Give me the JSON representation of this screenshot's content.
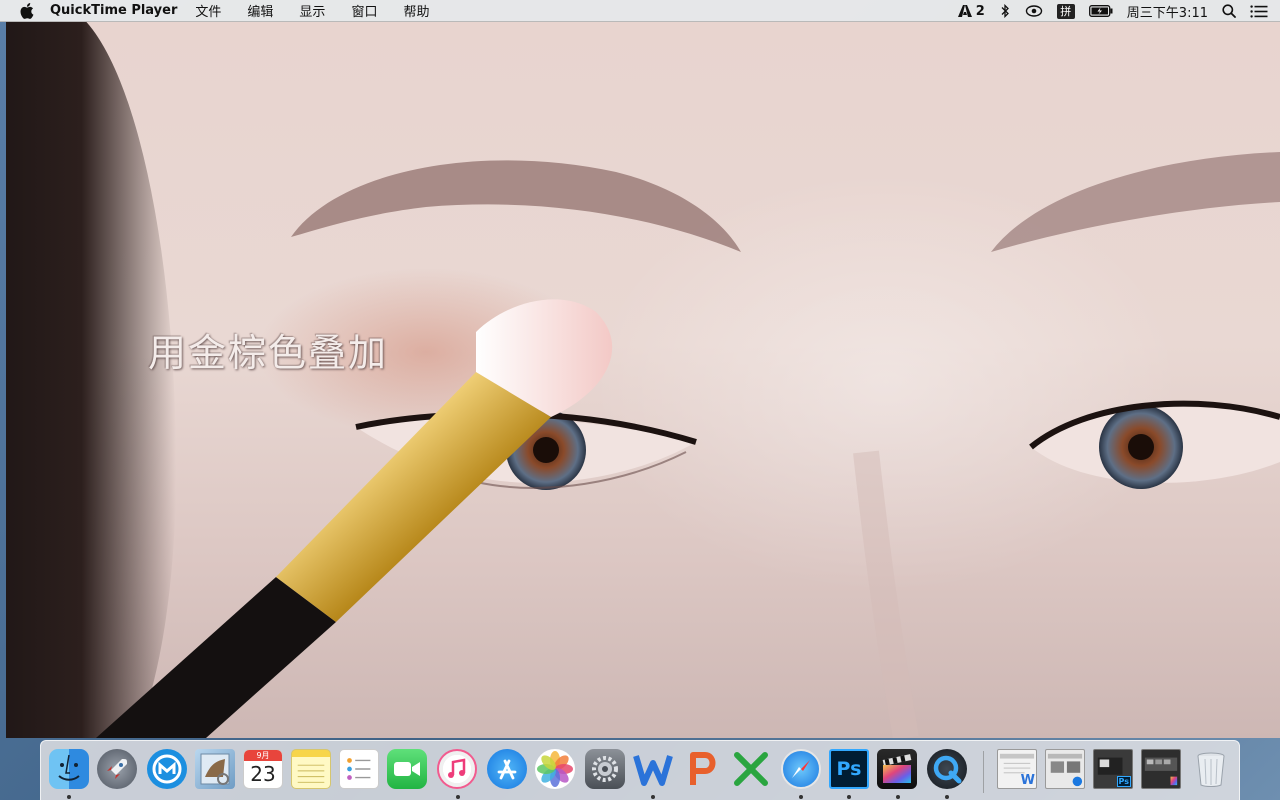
{
  "menubar": {
    "app_name": "QuickTime Player",
    "menus": [
      "文件",
      "编辑",
      "显示",
      "窗口",
      "帮助"
    ],
    "status": {
      "adobe_count": "2",
      "ime": "拼",
      "clock": "周三下午3:11"
    }
  },
  "video": {
    "caption": "用金棕色叠加"
  },
  "dock": {
    "calendar": {
      "month": "9月",
      "day": "23"
    },
    "apps": [
      {
        "name": "Finder",
        "icon": "finder-icon",
        "running": true
      },
      {
        "name": "Launchpad",
        "icon": "rocket-icon",
        "running": false
      },
      {
        "name": "Maxthon",
        "icon": "maxthon-icon",
        "running": false
      },
      {
        "name": "Preview",
        "icon": "preview-icon",
        "running": false
      },
      {
        "name": "Calendar",
        "icon": "calendar-icon",
        "running": false
      },
      {
        "name": "Notes",
        "icon": "notes-icon",
        "running": false
      },
      {
        "name": "Reminders",
        "icon": "reminders-icon",
        "running": false
      },
      {
        "name": "FaceTime",
        "icon": "facetime-icon",
        "running": false
      },
      {
        "name": "iTunes",
        "icon": "itunes-icon",
        "running": true
      },
      {
        "name": "App Store",
        "icon": "app-store-icon",
        "running": false
      },
      {
        "name": "Photos",
        "icon": "photos-icon",
        "running": false
      },
      {
        "name": "System Preferences",
        "icon": "gear-icon",
        "running": false
      },
      {
        "name": "WPS Writer",
        "icon": "wps-writer-icon",
        "running": true
      },
      {
        "name": "WPS Presentation",
        "icon": "wps-presentation-icon",
        "running": false
      },
      {
        "name": "WPS Spreadsheets",
        "icon": "wps-spreadsheets-icon",
        "running": false
      },
      {
        "name": "Safari",
        "icon": "safari-icon",
        "running": true
      },
      {
        "name": "Photoshop",
        "icon": "photoshop-icon",
        "running": true
      },
      {
        "name": "Final Cut Pro",
        "icon": "final-cut-icon",
        "running": true
      },
      {
        "name": "QuickTime Player",
        "icon": "quicktime-icon",
        "running": true
      }
    ],
    "photoshop_label": "Ps",
    "minimized_windows": [
      "Word document window",
      "Safari window",
      "Photoshop window",
      "Photoshop window"
    ],
    "minimized_badges": [
      "W",
      "Ps"
    ],
    "trash": {
      "name": "Trash",
      "icon": "trash-icon"
    }
  },
  "colors": {
    "menubar_bg": "#ececec",
    "dock_bg": "#e1e1e4",
    "photoshop": "#001d34",
    "wps_writer": "#2b73d9",
    "wps_presentation": "#e8602c",
    "wps_spreadsheets": "#2aa540"
  }
}
